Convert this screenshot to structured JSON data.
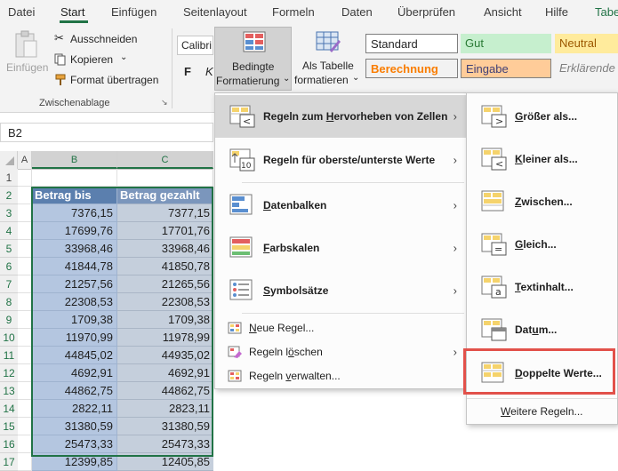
{
  "tabs": [
    "Datei",
    "Start",
    "Einfügen",
    "Seitenlayout",
    "Formeln",
    "Daten",
    "Überprüfen",
    "Ansicht",
    "Hilfe",
    "Tabe"
  ],
  "ribbon": {
    "paste_label": "Einfügen",
    "cut_label": "Ausschneiden",
    "copy_label": "Kopieren",
    "format_painter_label": "Format übertragen",
    "clipboard_group": "Zwischenablage",
    "font_name": "Calibri",
    "bold": "F",
    "italic": "K",
    "cond_format_line1": "Bedingte",
    "cond_format_line2": "Formatierung",
    "table_line1": "Als Tabelle",
    "table_line2": "formatieren",
    "styles": {
      "standard": "Standard",
      "gut": "Gut",
      "neutral": "Neutral",
      "berechnung": "Berechnung",
      "eingabe": "Eingabe",
      "erklaerend": "Erklärende"
    }
  },
  "formula_bar": {
    "cell_ref": "B2"
  },
  "grid": {
    "columns": [
      "A",
      "B",
      "C"
    ],
    "header_row": {
      "row": "2",
      "b": "Betrag bis",
      "c": "Betrag gezahlt"
    },
    "rows": [
      {
        "row": "1",
        "b": "",
        "c": ""
      },
      {
        "row": "3",
        "b": "7376,15",
        "c": "7377,15"
      },
      {
        "row": "4",
        "b": "17699,76",
        "c": "17701,76"
      },
      {
        "row": "5",
        "b": "33968,46",
        "c": "33968,46"
      },
      {
        "row": "6",
        "b": "41844,78",
        "c": "41850,78"
      },
      {
        "row": "7",
        "b": "21257,56",
        "c": "21265,56"
      },
      {
        "row": "8",
        "b": "22308,53",
        "c": "22308,53"
      },
      {
        "row": "9",
        "b": "1709,38",
        "c": "1709,38"
      },
      {
        "row": "10",
        "b": "11970,99",
        "c": "11978,99"
      },
      {
        "row": "11",
        "b": "44845,02",
        "c": "44935,02"
      },
      {
        "row": "12",
        "b": "4692,91",
        "c": "4692,91"
      },
      {
        "row": "13",
        "b": "44862,75",
        "c": "44862,75"
      },
      {
        "row": "14",
        "b": "2822,11",
        "c": "2823,11"
      },
      {
        "row": "15",
        "b": "31380,59",
        "c": "31380,59"
      },
      {
        "row": "16",
        "b": "25473,33",
        "c": "25473,33"
      },
      {
        "row": "17",
        "b": "12399,85",
        "c": "12405,85"
      }
    ]
  },
  "cf_menu": {
    "highlight_rules": {
      "pre": "Regeln zum ",
      "key": "H",
      "post": "ervorheben von Zellen"
    },
    "top_bottom_rules": "Regeln für oberste/unterste Werte",
    "data_bars": {
      "key": "D",
      "post": "atenbalken"
    },
    "color_scales": {
      "key": "F",
      "post": "arbskalen"
    },
    "icon_sets": {
      "key": "S",
      "post": "ymbolsätze"
    },
    "new_rule": {
      "key": "N",
      "post": "eue Regel..."
    },
    "clear_rules": {
      "pre": "Regeln l",
      "key": "ö",
      "post": "schen"
    },
    "manage_rules": {
      "pre": "Regeln ",
      "key": "v",
      "post": "erwalten..."
    }
  },
  "sub_menu": {
    "greater": {
      "key": "G",
      "post": "rößer als..."
    },
    "less": {
      "key": "K",
      "post": "leiner als..."
    },
    "between": {
      "key": "Z",
      "post": "wischen..."
    },
    "equal": {
      "key": "G",
      "post": "leich..."
    },
    "text_contains": {
      "key": "T",
      "post": "extinhalt..."
    },
    "date": {
      "pre": "Dat",
      "key": "u",
      "post": "m..."
    },
    "duplicates": {
      "key": "D",
      "post": "oppelte Werte..."
    },
    "more_rules": {
      "pre": "",
      "key": "W",
      "post": "eitere Regeln..."
    }
  },
  "colors": {
    "accent_green": "#217346",
    "highlight_red": "#e2514a",
    "menu_highlight": "#d7d7d7"
  }
}
